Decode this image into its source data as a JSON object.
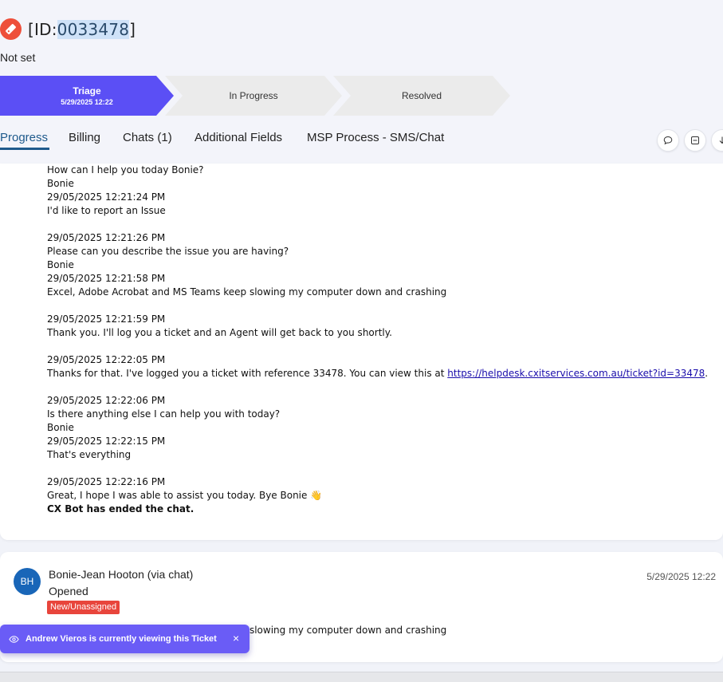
{
  "ticket": {
    "prefix": "[ID:",
    "id": "0033478",
    "suffix": "]",
    "subtitle": "Not set"
  },
  "stages": [
    {
      "name": "Triage",
      "date": "5/29/2025 12:22",
      "active": true
    },
    {
      "name": "In Progress"
    },
    {
      "name": "Resolved"
    }
  ],
  "tabs": [
    "Progress",
    "Billing",
    "Chats (1)",
    "Additional Fields",
    "MSP Process - SMS/Chat"
  ],
  "actions": {
    "icons": [
      "comment-icon",
      "minimize-icon",
      "download-icon"
    ]
  },
  "transcript": {
    "lines": [
      "How can I help you today Bonie?",
      "Bonie",
      "29/05/2025 12:21:24 PM",
      "I'd like to report an Issue",
      "",
      "29/05/2025 12:21:26 PM",
      "Please can you describe the issue you are having?",
      "Bonie",
      "29/05/2025 12:21:58 PM",
      "Excel, Adobe Acrobat and MS Teams keep slowing my computer down and crashing",
      "",
      "29/05/2025 12:21:59 PM",
      "Thank you. I'll log you a ticket and an Agent will get back to you shortly.",
      "",
      "29/05/2025 12:22:05 PM"
    ],
    "link_line": {
      "before": "Thanks for that. I've logged you a ticket with reference 33478. You can view this at ",
      "url": "https://helpdesk.cxitservices.com.au/ticket?id=33478",
      "after": "."
    },
    "lines_after": [
      "",
      "29/05/2025 12:22:06 PM",
      "Is there anything else I can help you with today?",
      "Bonie",
      "29/05/2025 12:22:15 PM",
      "That's everything",
      "",
      "29/05/2025 12:22:16 PM",
      "Great, I hope I was able to assist you today. Bye Bonie 👋"
    ],
    "ended": "CX Bot has ended the chat."
  },
  "entry": {
    "initials": "BH",
    "author": "Bonie-Jean Hooton (via chat)",
    "date": "5/29/2025 12:22",
    "status": "Opened",
    "badge": "New/Unassigned",
    "body": "Excel, Adobe Acrobat and MS Teams keep slowing my computer down and crashing"
  },
  "toast": {
    "text": "Andrew Vieros is currently viewing this Ticket",
    "close": "×"
  },
  "colors": {
    "accent": "#5b4ff5",
    "tab_active": "#1f5a8c",
    "badge": "#e8453c",
    "avatar": "#1966b8",
    "ticket_icon": "#ee4f3a"
  }
}
